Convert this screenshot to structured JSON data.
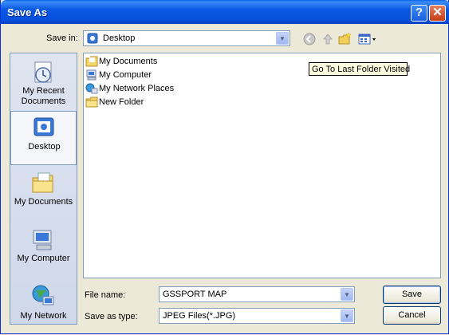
{
  "window": {
    "title": "Save As"
  },
  "titlebar": {
    "help": "?",
    "close": "✕"
  },
  "savein": {
    "label": "Save in:",
    "value": "Desktop"
  },
  "toolbar": {
    "icons": [
      "back-icon",
      "up-folder-icon",
      "new-folder-icon",
      "views-menu-icon"
    ]
  },
  "places": [
    {
      "label": "My Recent Documents",
      "icon": "recent-documents-icon"
    },
    {
      "label": "Desktop",
      "icon": "desktop-icon"
    },
    {
      "label": "My Documents",
      "icon": "my-documents-icon"
    },
    {
      "label": "My Computer",
      "icon": "my-computer-icon"
    },
    {
      "label": "My Network",
      "icon": "my-network-icon"
    }
  ],
  "files": [
    {
      "name": "My Documents",
      "icon": "my-documents-icon"
    },
    {
      "name": "My Computer",
      "icon": "my-computer-icon"
    },
    {
      "name": "My Network Places",
      "icon": "network-places-icon"
    },
    {
      "name": "New Folder",
      "icon": "folder-icon"
    }
  ],
  "tooltip": "Go To Last Folder Visited",
  "filename": {
    "label": "File name:",
    "value": "GSSPORT MAP"
  },
  "filetype": {
    "label": "Save as type:",
    "value": "JPEG Files(*.JPG)"
  },
  "buttons": {
    "save": "Save",
    "cancel": "Cancel"
  },
  "colors": {
    "titlebar": "#0a58e3",
    "dialog": "#ece9d8",
    "border": "#7f9db9",
    "tooltip": "#ffffe1"
  }
}
